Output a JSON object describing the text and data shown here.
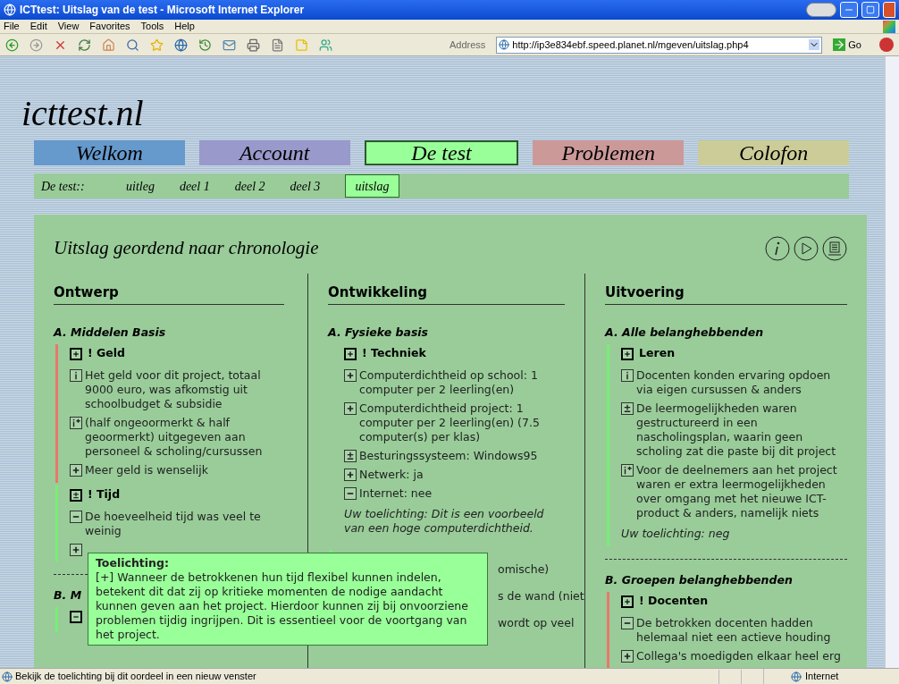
{
  "window": {
    "title": "ICTtest: Uitslag van de test - Microsoft Internet Explorer"
  },
  "menu": [
    "File",
    "Edit",
    "View",
    "Favorites",
    "Tools",
    "Help"
  ],
  "address": {
    "label": "Address",
    "value": "http://ip3e834ebf.speed.planet.nl/mgeven/uitslag.php4",
    "go": "Go"
  },
  "site": {
    "logo": "icttest.nl"
  },
  "nav": [
    {
      "label": "Welkom",
      "color": "#6699cc",
      "selected": false
    },
    {
      "label": "Account",
      "color": "#9999cc",
      "selected": false
    },
    {
      "label": "De test",
      "color": "#99ff99",
      "selected": true
    },
    {
      "label": "Problemen",
      "color": "#cc9999",
      "selected": false
    },
    {
      "label": "Colofon",
      "color": "#cccc99",
      "selected": false
    }
  ],
  "subnav": {
    "label": "De test::",
    "items": [
      {
        "label": "uitleg",
        "selected": false
      },
      {
        "label": "deel 1",
        "selected": false
      },
      {
        "label": "deel 2",
        "selected": false
      },
      {
        "label": "deel 3",
        "selected": false
      },
      {
        "label": "uitslag",
        "selected": true
      }
    ]
  },
  "page_title": "Uitslag geordend naar chronologie",
  "columns": [
    {
      "heading": "Ontwerp",
      "sections": [
        {
          "title": "A. Middelen Basis",
          "groups": [
            {
              "color": "#e8786a",
              "header": {
                "kind": "plus",
                "label": "! Geld"
              },
              "items": [
                {
                  "kind": "info",
                  "text": "Het geld voor dit project, totaal 9000 euro, was afkomstig uit schoolbudget & subsidie"
                },
                {
                  "kind": "info-plus",
                  "text": "(half ongeoormerkt & half geoormerkt) uitgegeven aan personeel & scholing/cursussen"
                },
                {
                  "kind": "plus",
                  "text": "Meer geld is wenselijk"
                }
              ]
            },
            {
              "color": "#77ee77",
              "header": {
                "kind": "plusminus",
                "label": "! Tijd"
              },
              "items": [
                {
                  "kind": "minus",
                  "text": "De hoeveelheid tijd was veel te weinig"
                },
                {
                  "kind": "plus"
                }
              ]
            }
          ]
        },
        {
          "title": "B. M",
          "groups": [
            {
              "color": "#77ee77",
              "header": {
                "kind": "minus"
              }
            }
          ]
        }
      ]
    },
    {
      "heading": "Ontwikkeling",
      "sections": [
        {
          "title": "A. Fysieke basis",
          "groups": [
            {
              "header": {
                "kind": "plus",
                "label": "! Techniek"
              },
              "items": [
                {
                  "kind": "plus",
                  "text": "Computerdichtheid op school: 1 computer per 2 leerling(en)"
                },
                {
                  "kind": "plus",
                  "text": "Computerdichtheid project: 1 computer per 2 leerling(en) (7.5 computer(s) per klas)"
                },
                {
                  "kind": "plusminus",
                  "text": "Besturingssysteem: Windows95"
                },
                {
                  "kind": "plus",
                  "text": "Netwerk: ja"
                },
                {
                  "kind": "minus",
                  "text": "Internet: nee"
                }
              ],
              "note": "Uw toelichting: Dit is een voorbeeld van een hoge computerdichtheid."
            }
          ]
        },
        {
          "groups": [
            {
              "color": "#77ee77",
              "items": [
                {
                  "kind": "fragment",
                  "text": "omische)"
                },
                {
                  "kind": "fragment",
                  "text": "s de wand (niet"
                },
                {
                  "kind": "fragment",
                  "text": "wordt op veel"
                }
              ]
            }
          ]
        }
      ]
    },
    {
      "heading": "Uitvoering",
      "sections": [
        {
          "title": "A. Alle belanghebbenden",
          "groups": [
            {
              "color": "#77ee77",
              "header": {
                "kind": "plus",
                "label": "Leren"
              },
              "items": [
                {
                  "kind": "info",
                  "text": "Docenten konden ervaring opdoen via eigen cursussen & anders"
                },
                {
                  "kind": "plusminus",
                  "text": "De leermogelijkheden waren gestructureerd in een nascholingsplan, waarin geen scholing zat die paste bij dit project"
                },
                {
                  "kind": "info-plus",
                  "text": "Voor de deelnemers aan het project waren er extra leermogelijkheden over omgang met het nieuwe ICT-product & anders, namelijk niets"
                }
              ],
              "note": "Uw toelichting: neg"
            }
          ]
        },
        {
          "title": "B. Groepen belanghebbenden",
          "groups": [
            {
              "color": "#e8786a",
              "header": {
                "kind": "plus",
                "label": "! Docenten"
              },
              "items": [
                {
                  "kind": "minus",
                  "text": "De betrokken docenten hadden helemaal niet een actieve houding"
                },
                {
                  "kind": "plus",
                  "text": "Collega's moedigden elkaar heel erg"
                }
              ]
            }
          ]
        }
      ]
    }
  ],
  "tooltip": {
    "title": "Toelichting:",
    "text": "[+] Wanneer de betrokkenen hun tijd flexibel kunnen indelen, betekent dit dat zij op kritieke momenten de nodige aandacht kunnen geven aan het project. Hierdoor kunnen zij bij onvoorziene problemen tijdig ingrijpen. Dit is essentieel voor de voortgang van het project."
  },
  "status_bar": {
    "text": "Bekijk de toelichting bij dit oordeel in een nieuw venster",
    "zone": "Internet"
  }
}
